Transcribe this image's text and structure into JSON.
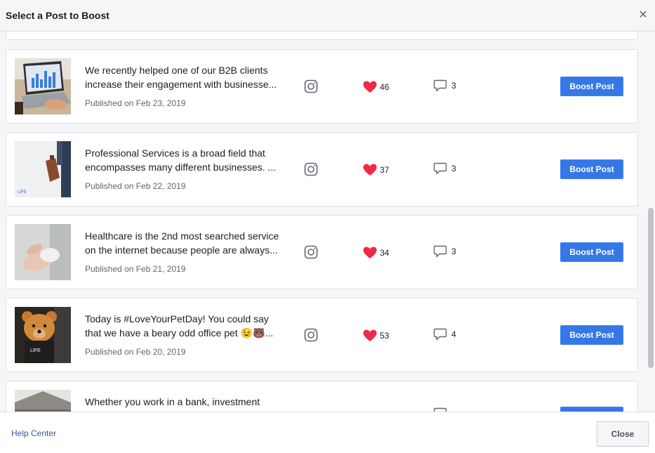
{
  "dialog": {
    "title": "Select a Post to Boost",
    "close_icon": "close-icon"
  },
  "posts": [
    {
      "line1": "We recently helped one of our B2B clients",
      "line2": "increase their engagement with businesse...",
      "date": "Published on Feb 23, 2019",
      "likes": "46",
      "comments": "3",
      "boost_label": "Boost Post",
      "thumb": "laptop-analytics"
    },
    {
      "line1": "Professional Services is a broad field that",
      "line2": "encompasses many different businesses. ...",
      "date": "Published on Feb 22, 2019",
      "likes": "37",
      "comments": "3",
      "boost_label": "Boost Post",
      "thumb": "briefcase"
    },
    {
      "line1": "Healthcare is the 2nd most searched service",
      "line2": "on the internet because people are always...",
      "date": "Published on Feb 21, 2019",
      "likes": "34",
      "comments": "3",
      "boost_label": "Boost Post",
      "thumb": "hands"
    },
    {
      "line1": "Today is #LoveYourPetDay! You could say",
      "line2": "that we have a beary odd office pet 😉🐻...",
      "date": "Published on Feb 20, 2019",
      "likes": "53",
      "comments": "4",
      "boost_label": "Boost Post",
      "thumb": "teddy-bear"
    },
    {
      "line1": "Whether you work in a bank, investment",
      "line2": "",
      "date": "",
      "likes": "",
      "comments": "",
      "boost_label": "",
      "thumb": "building"
    }
  ],
  "footer": {
    "help_label": "Help Center",
    "close_label": "Close"
  },
  "colors": {
    "accent": "#3578e5",
    "heart": "#f02849",
    "link": "#385898"
  }
}
